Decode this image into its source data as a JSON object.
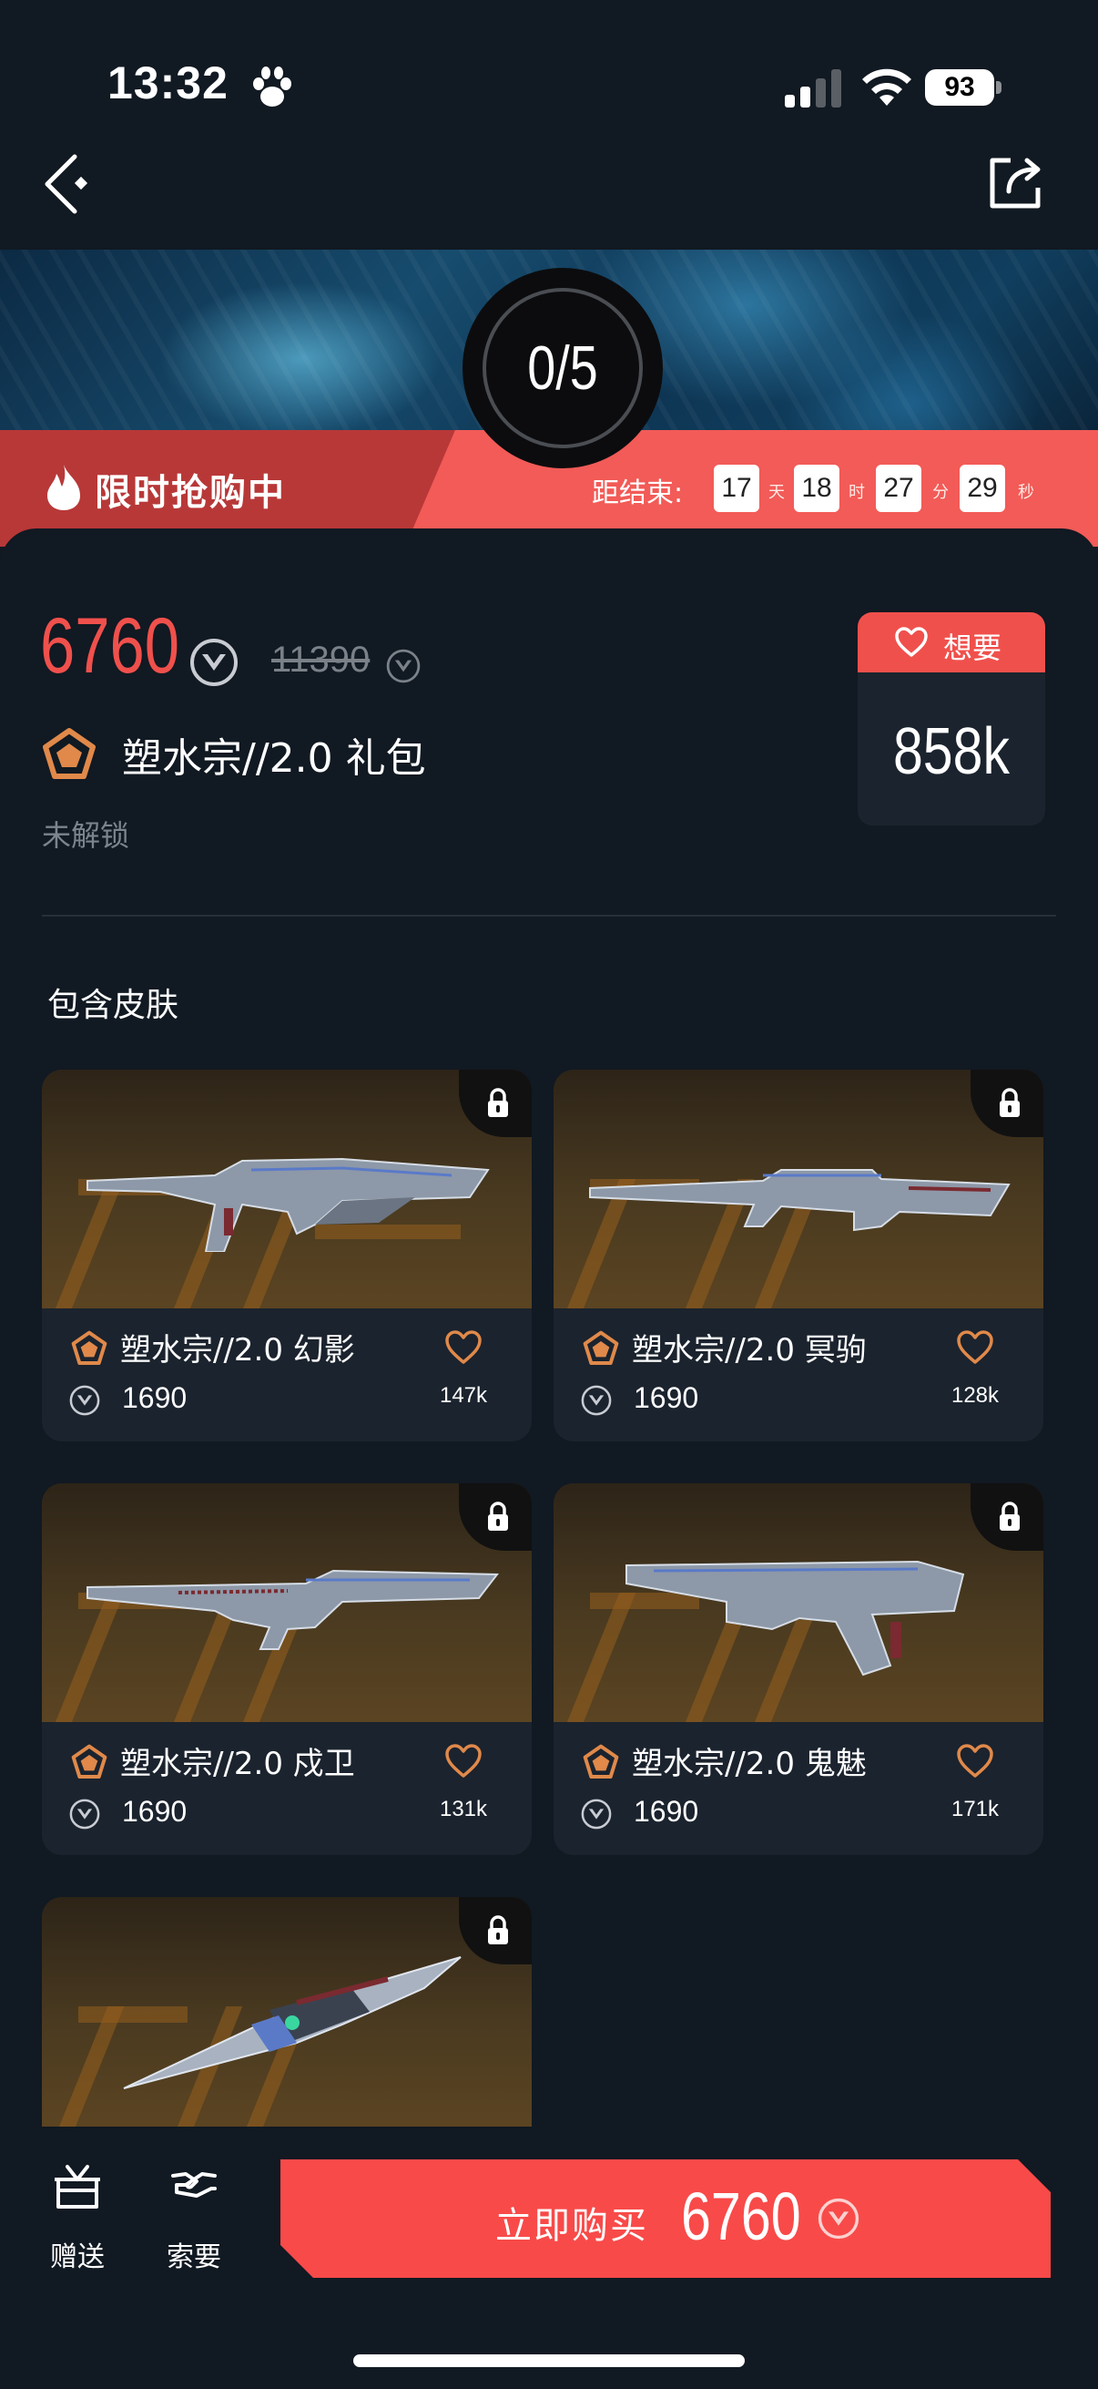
{
  "status_bar": {
    "time": "13:32",
    "battery": "93"
  },
  "banner": {
    "progress": "0/5"
  },
  "flash_sale": {
    "label": "限时抢购中",
    "countdown_label": "距结束:",
    "days": "17",
    "days_unit": "天",
    "hours": "18",
    "hours_unit": "时",
    "minutes": "27",
    "minutes_unit": "分",
    "seconds": "29",
    "seconds_unit": "秒"
  },
  "bundle": {
    "price": "6760",
    "original_price": "11390",
    "name": "塑水宗//2.0 礼包",
    "status": "未解锁"
  },
  "wishlist": {
    "label": "想要",
    "count": "858k"
  },
  "section": {
    "title": "包含皮肤"
  },
  "skins": [
    {
      "name": "塑水宗//2.0 幻影",
      "price": "1690",
      "likes": "147k"
    },
    {
      "name": "塑水宗//2.0 冥驹",
      "price": "1690",
      "likes": "128k"
    },
    {
      "name": "塑水宗//2.0 戍卫",
      "price": "1690",
      "likes": "131k"
    },
    {
      "name": "塑水宗//2.0 鬼魅",
      "price": "1690",
      "likes": "171k"
    }
  ],
  "bottom": {
    "gift_label": "赠送",
    "request_label": "索要",
    "buy_label": "立即购买",
    "buy_price": "6760"
  },
  "colors": {
    "accent": "#f0504c",
    "background": "#111922",
    "card": "#1b232e",
    "rank": "#e0894a"
  }
}
